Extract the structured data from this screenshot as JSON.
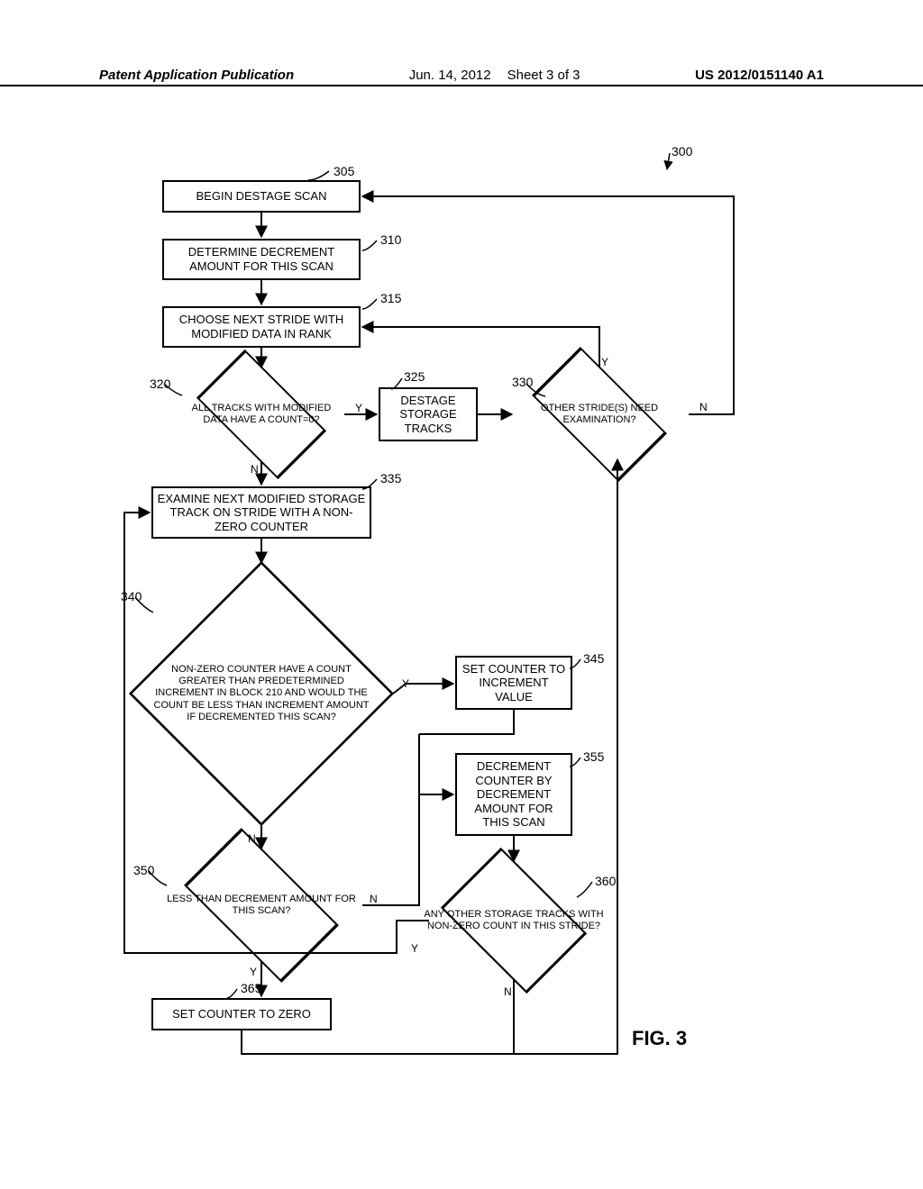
{
  "header": {
    "publication": "Patent Application Publication",
    "date": "Jun. 14, 2012",
    "sheet": "Sheet 3 of 3",
    "pubno": "US 2012/0151140 A1"
  },
  "refs": {
    "r300": "300",
    "r305": "305",
    "r310": "310",
    "r315": "315",
    "r320": "320",
    "r325": "325",
    "r330": "330",
    "r335": "335",
    "r340": "340",
    "r345": "345",
    "r350": "350",
    "r355": "355",
    "r360": "360",
    "r365": "365"
  },
  "nodes": {
    "n305": "BEGIN DESTAGE SCAN",
    "n310": "DETERMINE DECREMENT AMOUNT FOR THIS SCAN",
    "n315": "CHOOSE NEXT STRIDE WITH MODIFIED DATA IN RANK",
    "n320": "ALL TRACKS WITH MODIFIED DATA HAVE A COUNT=0?",
    "n325": "DESTAGE STORAGE TRACKS",
    "n330": "OTHER STRIDE(S) NEED EXAMINATION?",
    "n335": "EXAMINE NEXT MODIFIED STORAGE TRACK ON STRIDE WITH A NON-ZERO COUNTER",
    "n340": "NON-ZERO COUNTER HAVE A COUNT GREATER THAN PREDETERMINED INCREMENT IN BLOCK 210 AND WOULD THE COUNT BE LESS THAN INCREMENT AMOUNT IF DECREMENTED THIS SCAN?",
    "n345": "SET COUNTER TO INCREMENT VALUE",
    "n350": "LESS THAN DECREMENT AMOUNT FOR THIS SCAN?",
    "n355": "DECREMENT COUNTER BY DECREMENT AMOUNT FOR THIS SCAN",
    "n360": "ANY OTHER STORAGE TRACKS WITH NON-ZERO COUNT IN THIS STRIDE?",
    "n365": "SET COUNTER TO ZERO"
  },
  "labels": {
    "Y": "Y",
    "N": "N"
  },
  "figure": "FIG. 3"
}
